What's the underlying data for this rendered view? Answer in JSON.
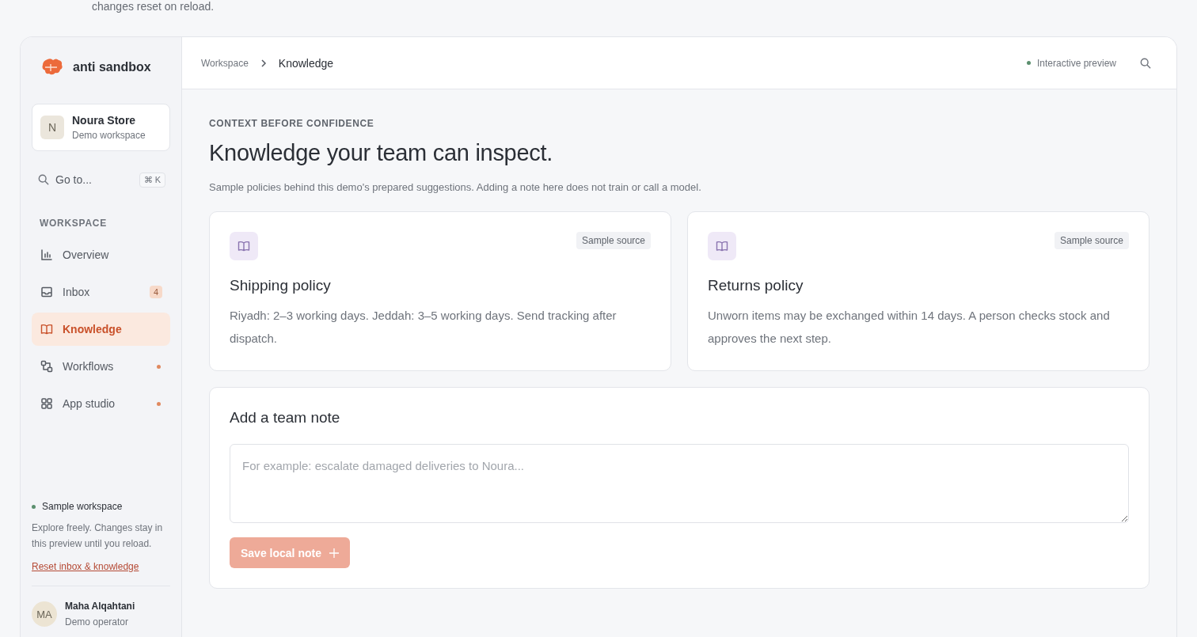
{
  "top_note": "changes reset on reload.",
  "brand": {
    "name": "anti sandbox"
  },
  "workspace_switcher": {
    "initial": "N",
    "name": "Noura Store",
    "subtitle": "Demo workspace"
  },
  "goto": {
    "label": "Go to...",
    "shortcut": "⌘ K"
  },
  "sidebar": {
    "section": "WORKSPACE",
    "items": [
      {
        "label": "Overview",
        "selected": false,
        "dot": false
      },
      {
        "label": "Inbox",
        "selected": false,
        "badge": "4",
        "dot": false
      },
      {
        "label": "Knowledge",
        "selected": true,
        "dot": false
      },
      {
        "label": "Workflows",
        "selected": false,
        "dot": true
      },
      {
        "label": "App studio",
        "selected": false,
        "dot": true
      }
    ]
  },
  "sample_box": {
    "status": "Sample workspace",
    "text": "Explore freely. Changes stay in this preview until you reload.",
    "link": "Reset inbox & knowledge"
  },
  "user": {
    "initials": "MA",
    "name": "Maha Alqahtani",
    "role": "Demo operator"
  },
  "breadcrumb": [
    "Workspace",
    "Knowledge"
  ],
  "header_status": "Interactive preview",
  "page": {
    "eyebrow": "CONTEXT BEFORE CONFIDENCE",
    "title": "Knowledge your team can inspect.",
    "description": "Sample policies behind this demo's prepared suggestions. Adding a note here does not train or call a model."
  },
  "sources": [
    {
      "tag": "Sample source",
      "title": "Shipping policy",
      "body": "Riyadh: 2–3 working days. Jeddah: 3–5 working days. Send tracking after dispatch."
    },
    {
      "tag": "Sample source",
      "title": "Returns policy",
      "body": "Unworn items may be exchanged within 14 days. A person checks stock and approves the next step."
    }
  ],
  "note_form": {
    "title": "Add a team note",
    "placeholder": "For example: escalate damaged deliveries to Noura...",
    "button": {
      "label": "Save local note",
      "disabled": true
    }
  }
}
